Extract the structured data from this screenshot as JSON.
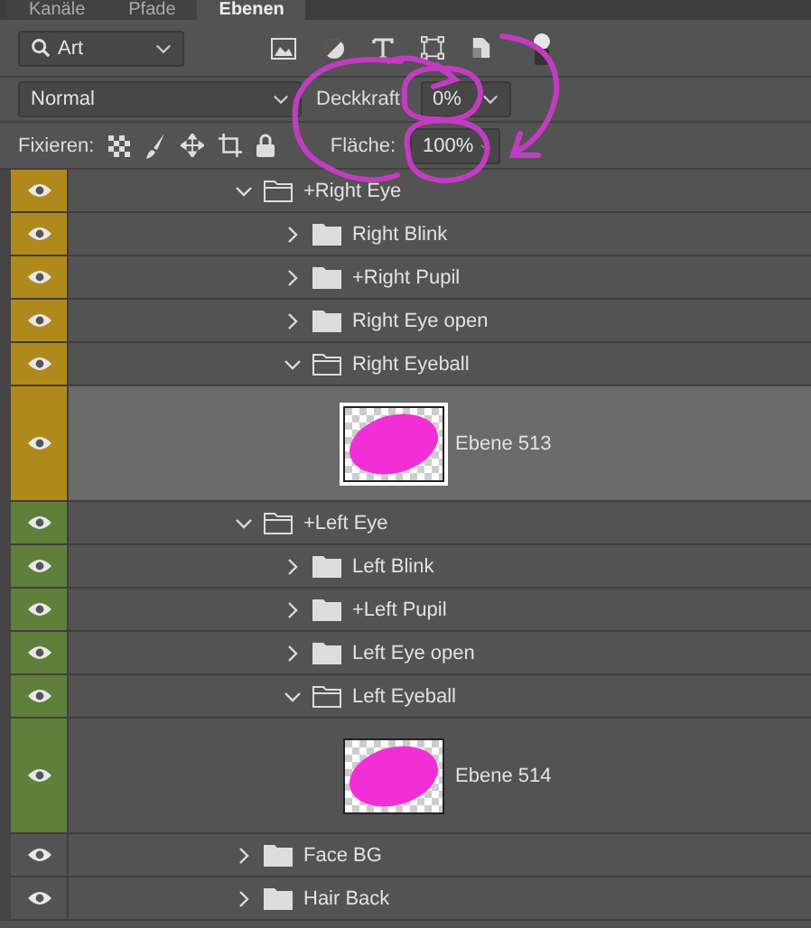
{
  "tabs": [
    {
      "label": "Kanäle",
      "selected": false
    },
    {
      "label": "Pfade",
      "selected": false
    },
    {
      "label": "Ebenen",
      "selected": true
    }
  ],
  "filter": {
    "value": "Art"
  },
  "blend_mode": {
    "value": "Normal"
  },
  "opacity": {
    "label": "Deckkraft:",
    "value": "0%"
  },
  "lock": {
    "label": "Fixieren:"
  },
  "fill": {
    "label": "Fläche:",
    "value": "100%"
  },
  "layers": [
    {
      "kind": "group",
      "name": "+Right Eye",
      "expanded": true,
      "visible": true,
      "selected": false,
      "color": "#b0891c",
      "children": [
        {
          "kind": "group",
          "name": "Right Blink",
          "expanded": false,
          "visible": true,
          "selected": false,
          "color": "#b0891c"
        },
        {
          "kind": "group",
          "name": "+Right Pupil",
          "expanded": false,
          "visible": true,
          "selected": false,
          "color": "#b0891c"
        },
        {
          "kind": "group",
          "name": "Right Eye open",
          "expanded": false,
          "visible": true,
          "selected": false,
          "color": "#b0891c"
        },
        {
          "kind": "group",
          "name": "Right Eyeball",
          "expanded": true,
          "visible": true,
          "selected": false,
          "color": "#b0891c",
          "children": [
            {
              "kind": "pixel",
              "name": "Ebene 513",
              "visible": true,
              "selected": true,
              "color": "#b0891c"
            }
          ]
        }
      ]
    },
    {
      "kind": "group",
      "name": "+Left Eye",
      "expanded": true,
      "visible": true,
      "selected": false,
      "color": "#5f7f3a",
      "children": [
        {
          "kind": "group",
          "name": "Left Blink",
          "expanded": false,
          "visible": true,
          "selected": false,
          "color": "#5f7f3a"
        },
        {
          "kind": "group",
          "name": "+Left Pupil",
          "expanded": false,
          "visible": true,
          "selected": false,
          "color": "#5f7f3a"
        },
        {
          "kind": "group",
          "name": "Left Eye open",
          "expanded": false,
          "visible": true,
          "selected": false,
          "color": "#5f7f3a"
        },
        {
          "kind": "group",
          "name": "Left Eyeball",
          "expanded": true,
          "visible": true,
          "selected": false,
          "color": "#5f7f3a",
          "children": [
            {
              "kind": "pixel",
              "name": "Ebene 514",
              "visible": true,
              "selected": false,
              "color": "#5f7f3a"
            }
          ]
        }
      ]
    },
    {
      "kind": "group",
      "name": "Face BG",
      "expanded": false,
      "visible": true,
      "selected": false
    },
    {
      "kind": "group",
      "name": "Hair Back",
      "expanded": false,
      "visible": true,
      "selected": false
    }
  ]
}
